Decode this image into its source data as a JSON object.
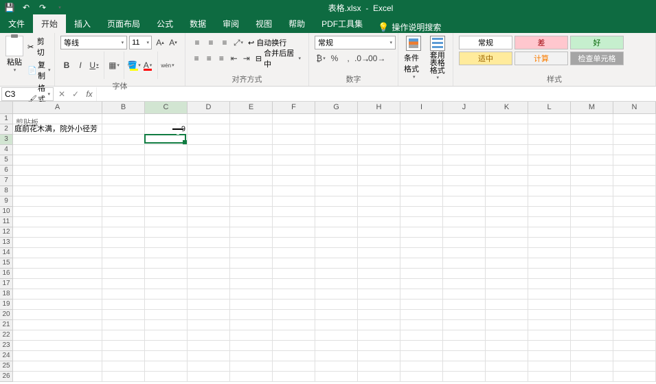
{
  "title": {
    "filename": "表格.xlsx",
    "app": "Excel"
  },
  "qat": {
    "save": "💾",
    "undo": "↶",
    "redo": "↷"
  },
  "tabs": {
    "file": "文件",
    "home": "开始",
    "insert": "插入",
    "layout": "页面布局",
    "formulas": "公式",
    "data": "数据",
    "review": "审阅",
    "view": "视图",
    "help": "帮助",
    "pdf": "PDF工具集",
    "tellme": "操作说明搜索"
  },
  "ribbon": {
    "clipboard": {
      "label": "剪贴板",
      "paste": "粘贴",
      "cut": "剪切",
      "copy": "复制",
      "painter": "格式刷"
    },
    "font": {
      "label": "字体",
      "name": "等线",
      "size": "11"
    },
    "align": {
      "label": "对齐方式",
      "wrap": "自动换行",
      "merge": "合并后居中"
    },
    "number": {
      "label": "数字",
      "format": "常规"
    },
    "styles": {
      "label": "样式",
      "cond": "条件格式",
      "table": "套用\n表格格式",
      "cells": {
        "normal": "常规",
        "bad": "差",
        "good": "好",
        "neutral": "适中",
        "calc": "计算",
        "check": "检查单元格"
      }
    }
  },
  "formula_bar": {
    "ref": "C3"
  },
  "sheet": {
    "cols": [
      "A",
      "B",
      "C",
      "D",
      "E",
      "F",
      "G",
      "H",
      "I",
      "J",
      "K",
      "L",
      "M",
      "N"
    ],
    "rows": 26,
    "cells": {
      "A2": "庭前花木满，院外小径芳",
      "C2": "9"
    },
    "selected": "C3",
    "selected_col": "C",
    "selected_row": 3
  }
}
